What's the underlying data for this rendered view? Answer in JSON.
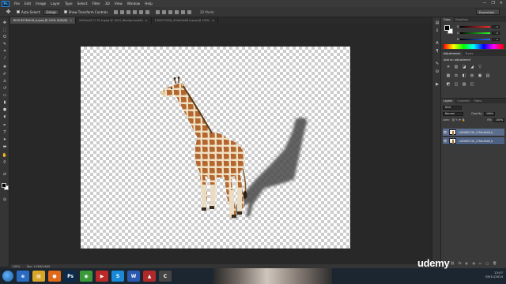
{
  "app": {
    "logo": "Ps",
    "menu": [
      "File",
      "Edit",
      "Image",
      "Layer",
      "Type",
      "Select",
      "Filter",
      "3D",
      "View",
      "Window",
      "Help"
    ],
    "window_controls": [
      "—",
      "❐",
      "✕"
    ]
  },
  "options": {
    "auto_select_label": "Auto-Select:",
    "auto_select_value": "Group",
    "show_transform_label": "Show Transform Controls",
    "mode_3d_label": "3D Mode:",
    "workspace": "Essentials"
  },
  "tabs": [
    {
      "label": "RCHI 65785e18_b.jpeg @ 100% (RGB/8)",
      "active": true
    },
    {
      "label": "5405ac0171 35 b.jpeg @ 100% (Background/8)",
      "active": false
    },
    {
      "label": "1405075526_47ab04a98 b.jpeg @ 100%",
      "active": false
    }
  ],
  "status": {
    "zoom": "100%",
    "doc_size": "Doc: 1.29M/2.64M"
  },
  "panels": {
    "color_tabs": [
      "Color",
      "Swatches"
    ],
    "sliders": [
      {
        "label": "R",
        "value": "0",
        "color": "#ff2a2a"
      },
      {
        "label": "G",
        "value": "0",
        "color": "#2aff2a"
      },
      {
        "label": "B",
        "value": "0",
        "color": "#2a6aff"
      }
    ],
    "adjust_tabs": [
      "Adjustments",
      "Styles"
    ],
    "adjust_title": "Add an adjustment",
    "adjust_row1": [
      "☀",
      "▥",
      "◪",
      "◢",
      "▽"
    ],
    "adjust_row2": [
      "▦",
      "⚖",
      "◧",
      "◍",
      "▣",
      "▤"
    ],
    "adjust_row3": [
      "◩",
      "◫",
      "▨",
      "◰"
    ],
    "layer_tabs": [
      "Layers",
      "Channels",
      "Paths"
    ],
    "kind_label": "Kind",
    "blend_mode": "Normal",
    "opacity_label": "Opacity:",
    "opacity_value": "100%",
    "lock_label": "Lock:",
    "fill_label": "Fill:",
    "fill_value": "100%",
    "layers": [
      {
        "name": "1465865156_278ac8a48_b",
        "selected": true
      },
      {
        "name": "1465865156_278ac8a48_b",
        "selected": true
      }
    ],
    "layer_footer": [
      "⛓",
      "fx",
      "◐",
      "◑",
      "▭",
      "▢",
      "🗑"
    ]
  },
  "taskbar": {
    "apps": [
      {
        "label": "e",
        "color": "#2a6cc4"
      },
      {
        "label": "▤",
        "color": "#d8a52a"
      },
      {
        "label": "●",
        "color": "#e06a1a"
      },
      {
        "label": "Ps",
        "color": "#0c2a4a"
      },
      {
        "label": "◉",
        "color": "#3a9a3a"
      },
      {
        "label": "▶",
        "color": "#bb2a2a"
      },
      {
        "label": "S",
        "color": "#1a8ad8"
      },
      {
        "label": "W",
        "color": "#2a5ab0"
      },
      {
        "label": "▲",
        "color": "#b02a2a"
      },
      {
        "label": "C",
        "color": "#444444"
      }
    ],
    "watermark": "udemy",
    "time": "13:57",
    "date": "05/11/2014"
  }
}
